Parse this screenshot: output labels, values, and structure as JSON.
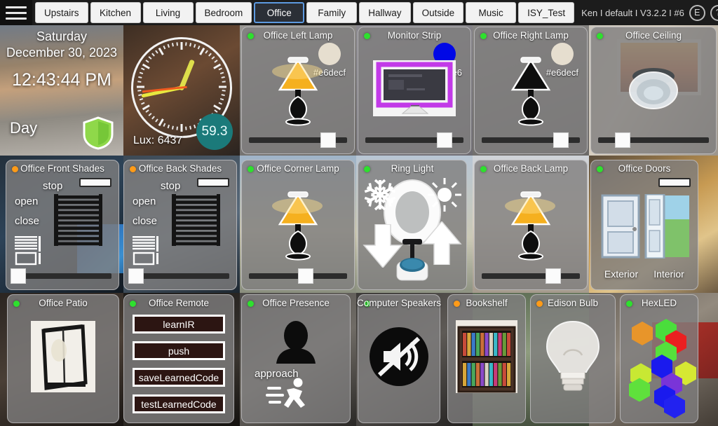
{
  "header": {
    "menu_icon": "hamburger-icon",
    "tabs": [
      {
        "label": "Upstairs",
        "active": false
      },
      {
        "label": "Kitchen",
        "active": false
      },
      {
        "label": "Living",
        "active": false
      },
      {
        "label": "Bedroom",
        "active": false
      },
      {
        "label": "Office",
        "active": true
      },
      {
        "label": "Family",
        "active": false
      },
      {
        "label": "Hallway",
        "active": false
      },
      {
        "label": "Outside",
        "active": false
      },
      {
        "label": "Music",
        "active": false
      },
      {
        "label": "ISY_Test",
        "active": false
      }
    ],
    "status": "Ken I default I V3.2.2 I #6",
    "edit_button": "E",
    "help_button": "?"
  },
  "datetime": {
    "weekday": "Saturday",
    "date": "December 30, 2023",
    "time": "12:43:44 PM",
    "mode": "Day",
    "shield_icon": "shield-icon"
  },
  "clock": {
    "lux_label": "Lux: 6437",
    "temperature": "59.3",
    "hour_deg": 22,
    "minute_deg": 258,
    "second_deg": 264
  },
  "cards": [
    {
      "id": "office-left-lamp",
      "title": "Office Left Lamp",
      "status": "green",
      "icon": "table-lamp-on-icon",
      "color_hex": "#e6decf",
      "slider_pct": 81
    },
    {
      "id": "monitor-strip",
      "title": "Monitor Strip",
      "status": "green",
      "icon": "monitor-led-strip-icon",
      "color_hex": "#0008e6",
      "slider_pct": 81
    },
    {
      "id": "office-right-lamp",
      "title": "Office Right Lamp",
      "status": "green",
      "icon": "table-lamp-off-icon",
      "color_hex": "#e6decf",
      "slider_pct": 81
    },
    {
      "id": "office-ceiling",
      "title": "Office Ceiling",
      "status": "green",
      "icon": "ceiling-light-icon",
      "slider_pct": 22
    },
    {
      "id": "office-front-shades",
      "title": "Office Front Shades",
      "status": "orange",
      "icon": "blinds-icon",
      "stop_label": "stop",
      "open_label": "open",
      "close_label": "close",
      "slider_pct": 1
    },
    {
      "id": "office-back-shades",
      "title": "Office Back Shades",
      "status": "orange",
      "icon": "blinds-icon",
      "stop_label": "stop",
      "open_label": "open",
      "close_label": "close",
      "slider_pct": 1
    },
    {
      "id": "office-corner-lamp",
      "title": "Office Corner Lamp",
      "status": "green",
      "icon": "table-lamp-on-icon",
      "slider_pct": 58
    },
    {
      "id": "ring-light",
      "title": "Ring Light",
      "status": "green",
      "icon": "ring-light-icon",
      "cool_icon": "snowflake-icon",
      "warm_icon": "sun-icon",
      "down_icon": "arrow-down-icon",
      "up_icon": "arrow-up-icon",
      "power_icon": "power-button-icon"
    },
    {
      "id": "office-back-lamp",
      "title": "Office Back Lamp",
      "status": "green",
      "icon": "table-lamp-on-icon",
      "slider_pct": 73
    },
    {
      "id": "office-doors",
      "title": "Office Doors",
      "status": "green",
      "exterior_label": "Exterior",
      "interior_label": "Interior",
      "exterior_icon": "door-closed-icon",
      "interior_icon": "door-open-icon"
    },
    {
      "id": "office-patio",
      "title": "Office Patio",
      "status": "green",
      "icon": "patio-lantern-icon"
    },
    {
      "id": "office-remote",
      "title": "Office Remote",
      "status": "green",
      "buttons": [
        "learnIR",
        "push",
        "saveLearnedCode",
        "testLearnedCode"
      ]
    },
    {
      "id": "office-presence",
      "title": "Office Presence",
      "status": "green",
      "icon": "person-silhouette-icon",
      "state_label": "approach",
      "motion_icon": "running-person-icon"
    },
    {
      "id": "computer-speakers",
      "title": "Computer Speakers",
      "status": "green",
      "icon": "speaker-muted-icon"
    },
    {
      "id": "bookshelf",
      "title": "Bookshelf",
      "status": "orange",
      "icon": "bookshelf-icon"
    },
    {
      "id": "edison-bulb",
      "title": "Edison Bulb",
      "status": "orange",
      "icon": "light-bulb-icon"
    },
    {
      "id": "hexled",
      "title": "HexLED",
      "status": "green",
      "icon": "hex-led-panel-icon",
      "hex_colors": [
        "#e8952a",
        "#4ade3c",
        "#ea2020",
        "#56e03c",
        "#1a1aee",
        "#c8e833",
        "#d6e833",
        "#7a34d8",
        "#5fe03c",
        "#1a1aee",
        "#2222f0"
      ]
    }
  ]
}
